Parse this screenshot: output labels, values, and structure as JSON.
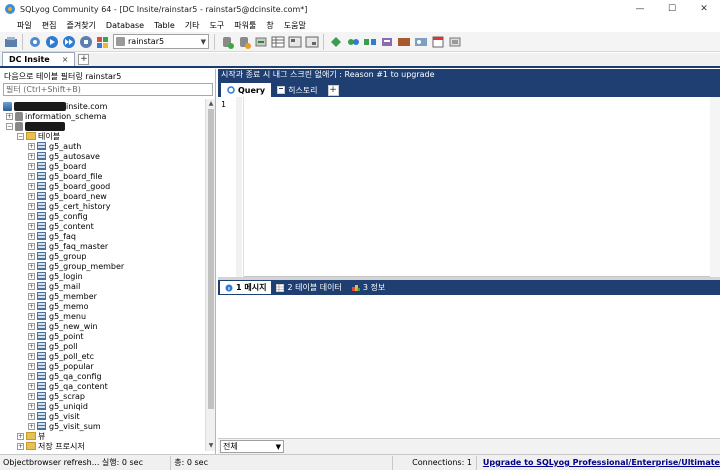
{
  "window": {
    "title": "SQLyog Community 64 - [DC Insite/rainstar5 - rainstar5@dcinsite.com*]",
    "controls": [
      "—",
      "☐",
      "✕"
    ]
  },
  "menu": [
    "파일",
    "편집",
    "즐겨찾기",
    "Database",
    "Table",
    "기타",
    "도구",
    "파워툴",
    "창",
    "도움말"
  ],
  "toolbar": {
    "db_selector_value": "rainstar5"
  },
  "connection_tabs": [
    {
      "label": "DC Insite",
      "close": "×"
    }
  ],
  "add_tab_symbol": "+",
  "object_browser": {
    "filter_label": "다음으로 테이블 필터링 rainstar5",
    "filter_placeholder": "필터 (Ctrl+Shift+B)",
    "server_label_suffix": "insite.com",
    "info_schema": "information_schema",
    "tables_folder": "테이블",
    "tables": [
      "g5_auth",
      "g5_autosave",
      "g5_board",
      "g5_board_file",
      "g5_board_good",
      "g5_board_new",
      "g5_cert_history",
      "g5_config",
      "g5_content",
      "g5_faq",
      "g5_faq_master",
      "g5_group",
      "g5_group_member",
      "g5_login",
      "g5_mail",
      "g5_member",
      "g5_memo",
      "g5_menu",
      "g5_new_win",
      "g5_point",
      "g5_poll",
      "g5_poll_etc",
      "g5_popular",
      "g5_qa_config",
      "g5_qa_content",
      "g5_scrap",
      "g5_uniqid",
      "g5_visit",
      "g5_visit_sum"
    ],
    "views_folder": "뷰",
    "procs_folder": "저장 프로시저"
  },
  "editor": {
    "promo_text": "시작과 종료 시 내그 스크린 없애기 : Reason #1 to upgrade",
    "tabs": [
      {
        "label": "Query",
        "active": true
      },
      {
        "label": "히스토리",
        "active": false
      }
    ],
    "line_number": "1"
  },
  "results_tabs": [
    {
      "num": "1",
      "label": "메시지",
      "active": true
    },
    {
      "num": "2",
      "label": "테이블 데이터",
      "active": false
    },
    {
      "num": "3",
      "label": "정보",
      "active": false
    }
  ],
  "results_filter": "전체",
  "status": {
    "refresh": "Objectbrowser refresh... 실행: 0 sec",
    "total": "총: 0 sec",
    "connections": "Connections: 1",
    "upgrade_link": "Upgrade to SQLyog Professional/Enterprise/Ultimate"
  }
}
